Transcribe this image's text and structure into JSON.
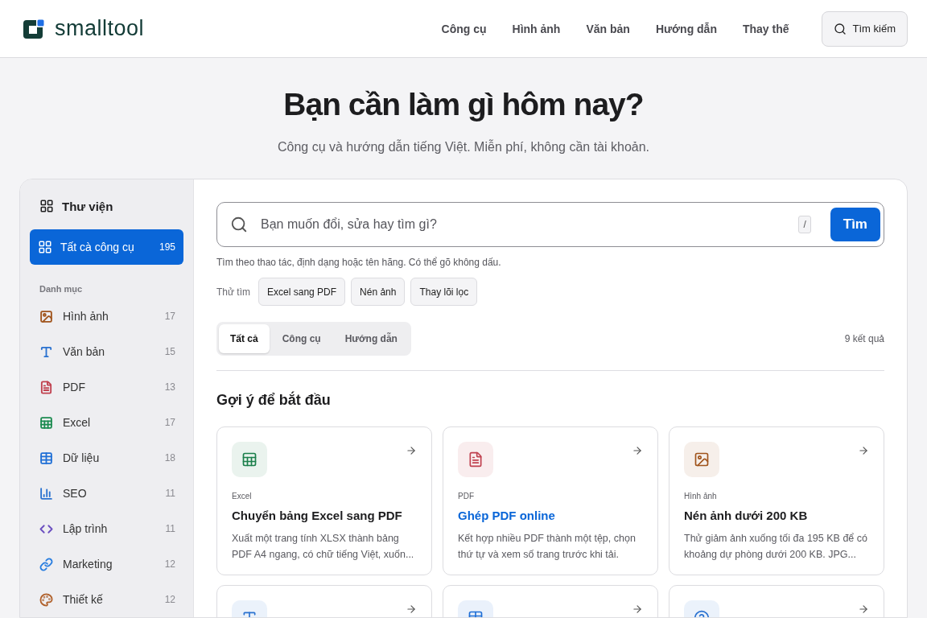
{
  "header": {
    "logo": "smalltool",
    "nav": [
      {
        "label": "Công cụ"
      },
      {
        "label": "Hình ảnh"
      },
      {
        "label": "Văn bản"
      },
      {
        "label": "Hướng dẫn"
      },
      {
        "label": "Thay thế"
      }
    ],
    "search_button": "Tìm kiếm"
  },
  "hero": {
    "title": "Bạn cần làm gì hôm nay?",
    "subtitle": "Công cụ và hướng dẫn tiếng Việt. Miễn phí, không cần tài khoản."
  },
  "sidebar": {
    "title": "Thư viện",
    "all": {
      "label": "Tất cà công cụ",
      "count": "195",
      "selected": true
    },
    "section": "Danh mục",
    "items": [
      {
        "label": "Hình ảnh",
        "count": "17",
        "color": "#a0541c",
        "selected": false
      },
      {
        "label": "Văn bản",
        "count": "15",
        "color": "#2a72d0",
        "selected": false
      },
      {
        "label": "PDF",
        "count": "13",
        "color": "#c0414f",
        "selected": false
      },
      {
        "label": "Excel",
        "count": "17",
        "color": "#1b8a4f",
        "selected": false
      },
      {
        "label": "Dữ liệu",
        "count": "18",
        "color": "#1f6fd6",
        "selected": false
      },
      {
        "label": "SEO",
        "count": "11",
        "color": "#2a72d0",
        "selected": false
      },
      {
        "label": "Lập trình",
        "count": "11",
        "color": "#6b4fc0",
        "selected": false
      },
      {
        "label": "Marketing",
        "count": "12",
        "color": "#2a7ee0",
        "selected": false
      },
      {
        "label": "Thiết kế",
        "count": "12",
        "color": "#b0602a",
        "selected": false
      }
    ]
  },
  "search": {
    "placeholder": "Bạn muốn đổi, sửa hay tìm gì?",
    "shortcut": "/",
    "button": "Tìm",
    "hint": "Tìm theo thao tác, định dạng hoặc tên hãng. Có thể gõ không dấu.",
    "try_label": "Thử tìm",
    "suggestions": [
      "Excel sang PDF",
      "Nén ảnh",
      "Thay lõi lọc"
    ]
  },
  "filter_tabs": [
    {
      "label": "Tất cả",
      "selected": true
    },
    {
      "label": "Công cụ",
      "selected": false
    },
    {
      "label": "Hướng dẫn",
      "selected": false
    }
  ],
  "result_count": "9 kết quả",
  "section_title": "Gợi ý để bắt đầu",
  "cards": [
    {
      "category": "Excel",
      "title": "Chuyển bảng Excel sang PDF",
      "description": "Xuất một trang tính XLSX thành bảng PDF A4 ngang, có chữ tiếng Việt, xuốn...",
      "color": "#1b7f4b",
      "highlighted": false
    },
    {
      "category": "PDF",
      "title": "Ghép PDF online",
      "description": "Kết hợp nhiều PDF thành một tệp, chọn thứ tự và xem số trang trước khi tải.",
      "color": "#c0414f",
      "highlighted": true
    },
    {
      "category": "Hình ảnh",
      "title": "Nén ảnh dưới 200 KB",
      "description": "Thử giảm ảnh xuống tối đa 195 KB để có khoảng dự phòng dưới 200 KB. JPG...",
      "color": "#a0541c",
      "highlighted": false
    },
    {
      "color": "#2a72d0"
    },
    {
      "color": "#1f6fd6"
    },
    {
      "color": "#2a72d0"
    }
  ]
}
